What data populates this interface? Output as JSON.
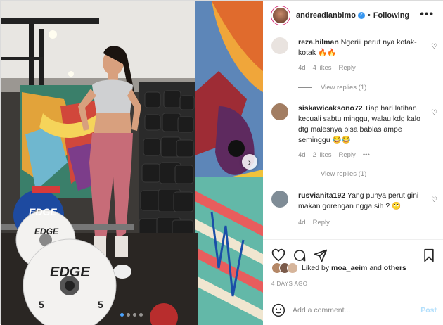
{
  "post": {
    "username": "andreadianbimo",
    "follow_label": "Following",
    "separator": "•",
    "more_label": "•••",
    "verified_mark": "✓"
  },
  "carousel": {
    "next_label": "›",
    "slide_count": 4,
    "active_slide": 1,
    "plate_label_1": "EDGE",
    "plate_label_2": "EDGE",
    "plate_label_3": "EDGE",
    "plate_weight": "5"
  },
  "comments": [
    {
      "user": "reza.hilman",
      "text": "Ngeriii perut nya kotak-kotak 🔥🔥",
      "time": "4d",
      "likes": "4 likes",
      "reply": "Reply",
      "view_replies": "View replies (1)",
      "avatar_color": "#e9e3df"
    },
    {
      "user": "siskawicaksono72",
      "text": "Tiap hari latihan kecuali sabtu minggu, walau kdg kalo dtg malesnya bisa bablas ampe seminggu 😂😂",
      "time": "4d",
      "likes": "2 likes",
      "reply": "Reply",
      "more": "•••",
      "view_replies": "View replies (1)",
      "avatar_color": "#a27d62"
    },
    {
      "user": "rusvianita192",
      "text": "Yang punya perut gini makan gorengan ngga sih ? 🙄",
      "time": "4d",
      "reply": "Reply",
      "avatar_color": "#7f8c96"
    }
  ],
  "likes": {
    "prefix": "Liked by",
    "user": "moa_aeim",
    "and": "and",
    "others": "others"
  },
  "date": "4 DAYS AGO",
  "add_comment": {
    "placeholder": "Add a comment...",
    "post_label": "Post"
  },
  "icons": [
    "heart-icon",
    "comment-icon",
    "share-icon",
    "bookmark-icon",
    "emoji-icon",
    "more-icon",
    "verified-icon",
    "chevron-right-icon"
  ]
}
